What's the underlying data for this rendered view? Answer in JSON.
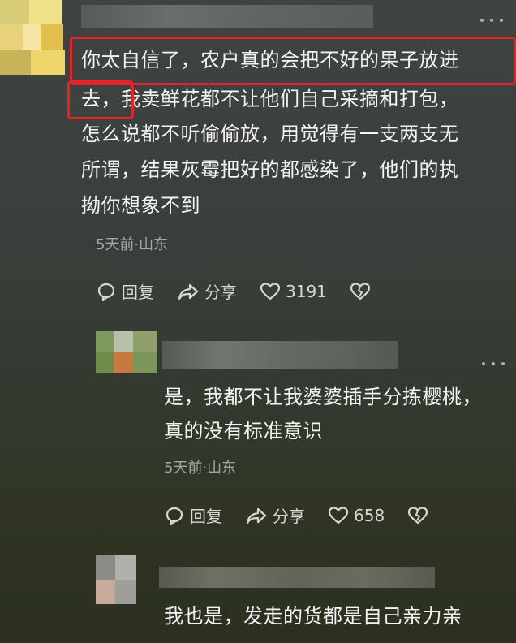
{
  "comments": [
    {
      "text_line1": "你太自信了，农户真的会把不好的果子放进",
      "text_line2_hl": "去，",
      "text_line2_rest": "我卖鲜花都不让他们自己采摘和打包，",
      "text_line3": "怎么说都不听偷偷放，用觉得有一支两支无",
      "text_line4": "所谓，结果灰霉把好的都感染了，他们的执",
      "text_line5": "拗你想象不到",
      "meta": "5天前·山东",
      "reply_label": "回复",
      "share_label": "分享",
      "like_count": "3191"
    },
    {
      "text_line1": "是，我都不让我婆婆插手分拣樱桃，",
      "text_line2": "真的没有标准意识",
      "meta": "5天前·山东",
      "reply_label": "回复",
      "share_label": "分享",
      "like_count": "658"
    },
    {
      "text_line1": "我也是，发走的货都是自己亲力亲"
    }
  ],
  "more_icon": "more-dots-icon",
  "colors": {
    "highlight": "#e5242a",
    "text": "#f4f4f4",
    "meta": "#a3a8a3"
  }
}
